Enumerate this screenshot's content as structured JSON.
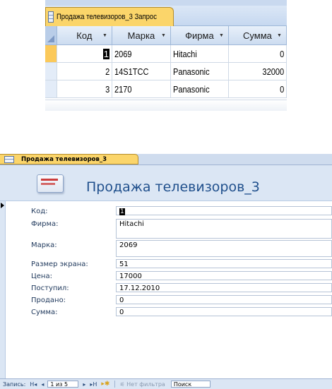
{
  "query": {
    "tab_title": "Продажа телевизоров_3 Запрос",
    "columns": [
      "Код",
      "Марка",
      "Фирма",
      "Сумма"
    ],
    "rows": [
      {
        "kod": "1",
        "marka": "2069",
        "firma": "Hitachi",
        "summa": "0",
        "selected": true
      },
      {
        "kod": "2",
        "marka": "14S1TCC",
        "firma": "Panasonic",
        "summa": "32000"
      },
      {
        "kod": "3",
        "marka": "2170",
        "firma": "Panasonic",
        "summa": "0"
      }
    ]
  },
  "form": {
    "tab_title": "Продажа телевизоров_3",
    "header_title": "Продажа телевизоров_3",
    "fields": [
      {
        "label": "Код:",
        "value": "1"
      },
      {
        "label": "Фирма:",
        "value": "Hitachi"
      },
      {
        "label": "Марка:",
        "value": "2069"
      },
      {
        "label": "Размер экрана:",
        "value": "51"
      },
      {
        "label": "Цена:",
        "value": "17000"
      },
      {
        "label": "Поступил:",
        "value": "17.12.2010"
      },
      {
        "label": "Продано:",
        "value": "0"
      },
      {
        "label": "Сумма:",
        "value": "0"
      }
    ]
  },
  "navbar": {
    "record_label": "Запись:",
    "first": "H◂",
    "prev": "◂",
    "position": "1 из 5",
    "next": "▸",
    "last": "▸H",
    "new": "▸✱",
    "filter_icon": "funnel-icon",
    "filter_label": "Нет фильтра",
    "search_label": "Поиск"
  }
}
